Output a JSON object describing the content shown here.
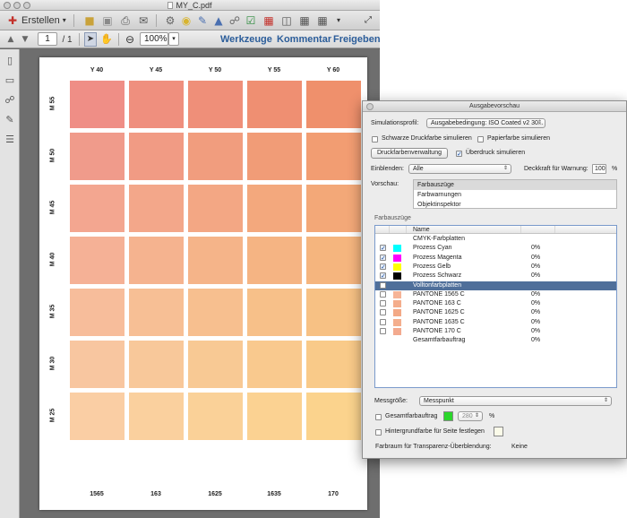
{
  "window": {
    "title": "MY_C.pdf"
  },
  "toolbar": {
    "erstellen_label": "Erstellen",
    "page_current": "1",
    "page_total": "/ 1",
    "zoom": "100%",
    "werkzeuge": "Werkzeuge",
    "kommentar": "Kommentar",
    "freigeben": "Freigeben"
  },
  "page": {
    "columns": [
      "Y 40",
      "Y 45",
      "Y 50",
      "Y 55",
      "Y 60"
    ],
    "rows": [
      "M 55",
      "M 50",
      "M 45",
      "M 40",
      "M 35",
      "M 30",
      "M 25"
    ],
    "swatch_colors": [
      [
        "#ef8e86",
        "#ef8f7e",
        "#ef8f79",
        "#ef8f72",
        "#ef906c"
      ],
      [
        "#f09b8b",
        "#f19b84",
        "#f19d7e",
        "#f19c77",
        "#f29d72"
      ],
      [
        "#f3a690",
        "#f3a78a",
        "#f3a784",
        "#f3a87d",
        "#f3a878"
      ],
      [
        "#f5b196",
        "#f5b38f",
        "#f5b489",
        "#f5b483",
        "#f5b57e"
      ],
      [
        "#f7bd9b",
        "#f7bf95",
        "#f7bf8f",
        "#f7c089",
        "#f7c184"
      ],
      [
        "#f8c6a0",
        "#f8c89a",
        "#f8c994",
        "#f9c98e",
        "#f9ca89"
      ],
      [
        "#face a4",
        "#fad09e",
        "#fad198",
        "#fbd292",
        "#fbd38d"
      ]
    ],
    "footer": [
      "1565",
      "163",
      "1625",
      "1635",
      "170"
    ]
  },
  "dialog": {
    "title": "Ausgabevorschau",
    "simulationsprofil_label": "Simulationsprofil:",
    "simulationsprofil_value": "Ausgabebedingung: ISO Coated v2 30...",
    "schwarze_label": "Schwarze Druckfarbe simulieren",
    "papierfarbe_label": "Papierfarbe simulieren",
    "druckfarben_button": "Druckfarbenverwaltung",
    "ueberdruck_label": "Überdruck simulieren",
    "einblenden_label": "Einblenden:",
    "einblenden_value": "Alle",
    "deckkraft_label": "Deckkraft für Warnung:",
    "deckkraft_value": "100",
    "deckkraft_unit": "%",
    "vorschau_label": "Vorschau:",
    "vorschau_items": [
      "Farbauszüge",
      "Farbwarnungen",
      "Objektinspektor"
    ],
    "farbauszuege_label": "Farbauszüge",
    "table_header_name": "Name",
    "separations": [
      {
        "name": "CMYK-Farbplatten",
        "pct": "",
        "checked": null,
        "chip": ""
      },
      {
        "name": "Prozess Cyan",
        "pct": "0%",
        "checked": true,
        "chip": "#00ffff"
      },
      {
        "name": "Prozess Magenta",
        "pct": "0%",
        "checked": true,
        "chip": "#ff00ff"
      },
      {
        "name": "Prozess Gelb",
        "pct": "0%",
        "checked": true,
        "chip": "#ffff00"
      },
      {
        "name": "Prozess Schwarz",
        "pct": "0%",
        "checked": true,
        "chip": "#000000"
      },
      {
        "name": "Volltonfarbplatten",
        "pct": "",
        "checked": false,
        "chip": ""
      },
      {
        "name": "PANTONE 1565 C",
        "pct": "0%",
        "checked": false,
        "chip": "#f6b497"
      },
      {
        "name": "PANTONE 163 C",
        "pct": "0%",
        "checked": false,
        "chip": "#f4ad8c"
      },
      {
        "name": "PANTONE 1625 C",
        "pct": "0%",
        "checked": false,
        "chip": "#f3a986"
      },
      {
        "name": "PANTONE 1635 C",
        "pct": "0%",
        "checked": false,
        "chip": "#f4ae8d"
      },
      {
        "name": "PANTONE 170 C",
        "pct": "0%",
        "checked": false,
        "chip": "#f3aa8f"
      },
      {
        "name": "Gesamtfarbauftrag",
        "pct": "0%",
        "checked": null,
        "chip": ""
      }
    ],
    "messgroesse_label": "Messgröße:",
    "messgroesse_value": "Messpunkt",
    "gesamtfarbauftrag_label": "Gesamtfarbauftrag",
    "gesamtfarbauftrag_value": "280",
    "gesamtfarbauftrag_unit": "%",
    "hintergrund_label": "Hintergrundfarbe für Seite festlegen",
    "farbraum_label": "Farbraum für Transparenz-Überblendung:",
    "farbraum_value": "Keine"
  }
}
